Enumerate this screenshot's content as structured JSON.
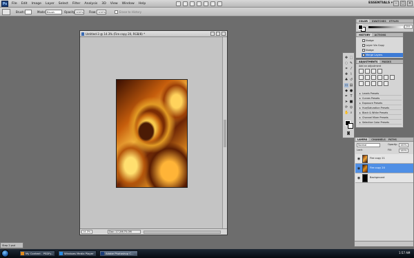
{
  "menubar": {
    "logo": "Ps",
    "items": [
      "File",
      "Edit",
      "Image",
      "Layer",
      "Select",
      "Filter",
      "Analysis",
      "3D",
      "View",
      "Window",
      "Help"
    ],
    "workspace": "ESSENTIALS ▾",
    "window_controls": [
      "–",
      "□",
      "×"
    ]
  },
  "options": {
    "brush_label": "Brush:",
    "mode_label": "Mode:",
    "mode_value": "Brush",
    "opacity_label": "Opacity:",
    "opacity_value": "100%",
    "flow_label": "Flow:",
    "flow_value": "100%",
    "erase_label": "Erase to History"
  },
  "document": {
    "title": "Untitled-3 @ 14.3% (Fire copy 20, RGB/8) *",
    "zoom": "14.3%",
    "doc_info": "Doc: 17.2M/75.0M"
  },
  "color_panel": {
    "tabs": [
      "COLOR",
      "SWATCHES",
      "STYLES"
    ],
    "value": "255"
  },
  "history_panel": {
    "tabs": [
      "HISTORY",
      "ACTIONS"
    ],
    "items": [
      "Nudge",
      "Layer Via Copy",
      "Nudge",
      "Merge Layers"
    ]
  },
  "adjustments_panel": {
    "tabs": [
      "ADJUSTMENTS",
      "MASKS"
    ],
    "title": "Add an adjustment",
    "presets": [
      "Levels Presets",
      "Curves Presets",
      "Exposure Presets",
      "Hue/Saturation Presets",
      "Black & White Presets",
      "Channel Mixer Presets",
      "Selective Color Presets"
    ]
  },
  "layers_panel": {
    "tabs": [
      "LAYERS",
      "CHANNELS",
      "PATHS"
    ],
    "blend_mode": "Normal",
    "opacity_label": "Opacity:",
    "opacity_value": "100%",
    "lock_label": "Lock:",
    "fill_label": "Fill:",
    "fill_value": "100%",
    "layers": [
      {
        "name": "Fire copy 21",
        "selected": false
      },
      {
        "name": "Fire copy 20",
        "selected": true
      },
      {
        "name": "Background",
        "selected": false
      }
    ]
  },
  "doc_tab": "Step 2.psd",
  "taskbar": {
    "buttons": [
      "My Content - PSDFy...",
      "Windows Media Player",
      "Adobe Photoshop C..."
    ],
    "clock": "1:57 AM"
  },
  "colors": {
    "selection": "#3d7bd6",
    "taskbar": "#0b121a",
    "workspace_bg": "#6d6d6d"
  }
}
